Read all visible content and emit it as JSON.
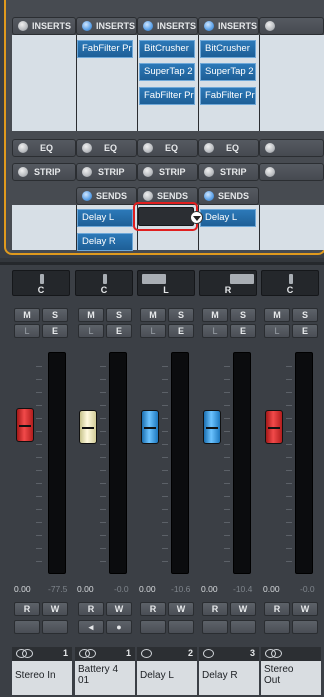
{
  "rack": {
    "inserts_label": "INSERTS",
    "eq_label": "EQ",
    "strip_label": "STRIP",
    "sends_label": "SENDS",
    "insert_slots": {
      "col2": [
        "FabFilter Pr"
      ],
      "col3": [
        "BitCrusher",
        "SuperTap 2",
        "FabFilter Pr"
      ],
      "col4": [
        "BitCrusher",
        "SuperTap 2",
        "FabFilter Pr"
      ]
    },
    "send_slots": {
      "col2": [
        "Delay L",
        "Delay R"
      ],
      "col4": [
        "Delay L"
      ]
    }
  },
  "mixer": {
    "channels": [
      {
        "name": "Stereo In",
        "number": "1",
        "pan": "C",
        "fader_value": "0.00",
        "peak": "-77.5",
        "fader_color": "red"
      },
      {
        "name": "Battery 4 01",
        "number": "1",
        "pan": "C",
        "fader_value": "0.00",
        "peak": "-0.0",
        "fader_color": "yellow"
      },
      {
        "name": "Delay L",
        "number": "2",
        "pan": "L",
        "fader_value": "0.00",
        "peak": "-10.6",
        "fader_color": "blue"
      },
      {
        "name": "Delay R",
        "number": "3",
        "pan": "R",
        "fader_value": "0.00",
        "peak": "-10.4",
        "fader_color": "blue"
      },
      {
        "name": "Stereo Out",
        "number": "",
        "pan": "C",
        "fader_value": "0.00",
        "peak": "-0.0",
        "fader_color": "red"
      }
    ],
    "mute_label": "M",
    "solo_label": "S",
    "listen_label": "L",
    "edit_label": "E",
    "read_label": "R",
    "write_label": "W"
  },
  "colors": {
    "accent_orange": "#e09a1e",
    "highlight_red": "#e01f1f",
    "plugin_blue": "#2c79b8"
  }
}
